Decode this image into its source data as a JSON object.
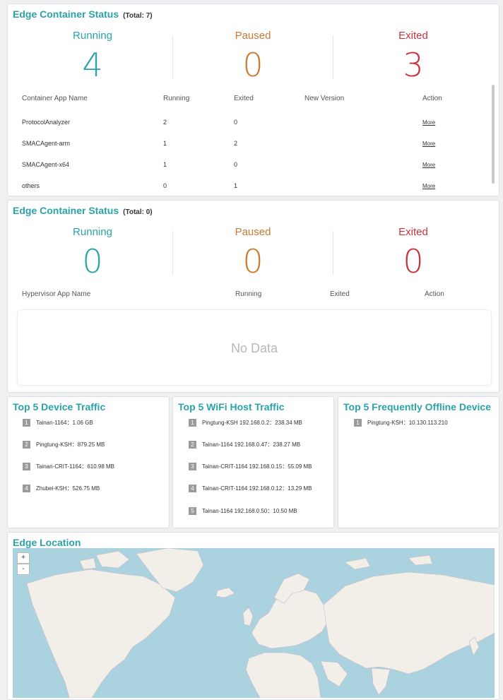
{
  "container_status": {
    "title": "Edge Container Status",
    "total": "(Total: 7)",
    "running_label": "Running",
    "running_value": "4",
    "paused_label": "Paused",
    "paused_value": "0",
    "exited_label": "Exited",
    "exited_value": "3",
    "columns": [
      "Container App Name",
      "Running",
      "Exited",
      "New Version",
      "Action"
    ],
    "rows": [
      {
        "name": "ProtocolAnalyzer",
        "running": "2",
        "exited": "0",
        "new_version": "",
        "action": "More"
      },
      {
        "name": "SMACAgent-arm",
        "running": "1",
        "exited": "2",
        "new_version": "",
        "action": "More"
      },
      {
        "name": "SMACAgent-x64",
        "running": "1",
        "exited": "0",
        "new_version": "",
        "action": "More"
      },
      {
        "name": "others",
        "running": "0",
        "exited": "1",
        "new_version": "",
        "action": "More"
      }
    ]
  },
  "hypervisor_status": {
    "title": "Edge Container Status",
    "total": "(Total: 0)",
    "running_label": "Running",
    "running_value": "0",
    "paused_label": "Paused",
    "paused_value": "0",
    "exited_label": "Exited",
    "exited_value": "0",
    "columns": [
      "Hypervisor App Name",
      "Running",
      "Exited",
      "Action"
    ],
    "no_data": "No Data"
  },
  "device_traffic": {
    "title": "Top 5 Device Traffic",
    "items": [
      {
        "rank": "1",
        "text": "Tainan-1164：1.06 GB"
      },
      {
        "rank": "2",
        "text": "Pingtung-KSH：879.25 MB"
      },
      {
        "rank": "3",
        "text": "Tainan-CRIT-1164：610.98 MB"
      },
      {
        "rank": "4",
        "text": "Zhubei-KSH：526.75 MB"
      }
    ]
  },
  "wifi_traffic": {
    "title": "Top 5 WiFi Host Traffic",
    "items": [
      {
        "rank": "1",
        "text": "Pingtung-KSH 192.168.0.2：238.34 MB"
      },
      {
        "rank": "2",
        "text": "Tainan-1164 192.168.0.47：238.27 MB"
      },
      {
        "rank": "3",
        "text": "Tainan-CRIT-1164 192.168.0.15：55.09 MB"
      },
      {
        "rank": "4",
        "text": "Tainan-CRIT-1164 192.168.0.12：13.29 MB"
      },
      {
        "rank": "5",
        "text": "Tainan-1164 192.168.0.50：10.50 MB"
      }
    ]
  },
  "offline_device": {
    "title": "Top 5 Frequently Offline Device",
    "items": [
      {
        "rank": "1",
        "text": "Pingtung-KSH：10.130.113.210"
      }
    ]
  },
  "edge_location": {
    "title": "Edge Location",
    "zoom_in": "+",
    "zoom_out": "-"
  },
  "colors": {
    "accent": "#2aa3a8",
    "running": "#2aa3a8",
    "paused": "#c97a33",
    "exited": "#c8323c",
    "map_water": "#aad3df",
    "map_land": "#f2efe9"
  }
}
